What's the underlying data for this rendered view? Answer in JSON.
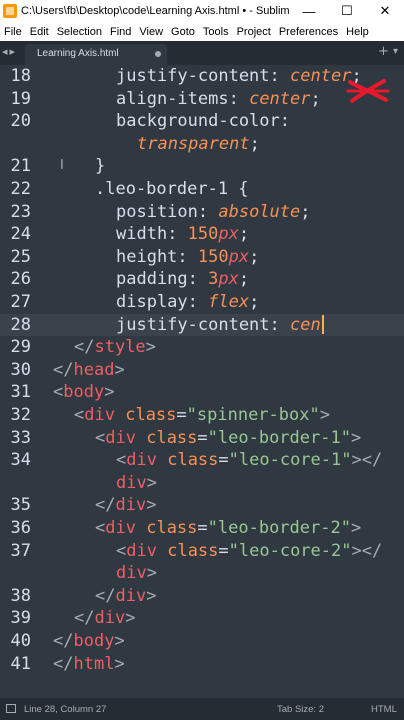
{
  "window": {
    "title": "C:\\Users\\fb\\Desktop\\code\\Learning Axis.html • - Sublime Te...",
    "minimize": "—",
    "maximize": "☐",
    "close": "✕"
  },
  "menu": [
    "File",
    "Edit",
    "Selection",
    "Find",
    "View",
    "Goto",
    "Tools",
    "Project",
    "Preferences",
    "Help"
  ],
  "tabbar": {
    "nav": "◂▸",
    "tab_label": "Learning Axis.html",
    "new_tab": "+",
    "dropdown": "▾"
  },
  "editor": {
    "cursor_line": 28,
    "lines": [
      {
        "n": "18",
        "indent": 3,
        "tokens": [
          {
            "t": "justify-content",
            "c": "k"
          },
          {
            "t": ": ",
            "c": "pun"
          },
          {
            "t": "center",
            "c": "v"
          },
          {
            "t": ";",
            "c": "pun"
          }
        ]
      },
      {
        "n": "19",
        "indent": 3,
        "tokens": [
          {
            "t": "align-items",
            "c": "k"
          },
          {
            "t": ": ",
            "c": "pun"
          },
          {
            "t": "center",
            "c": "v"
          },
          {
            "t": ";",
            "c": "pun"
          }
        ]
      },
      {
        "n": "20",
        "indent": 3,
        "tokens": [
          {
            "t": "background-color",
            "c": "k"
          },
          {
            "t": ":",
            "c": "pun"
          }
        ]
      },
      {
        "n": "",
        "indent": 4,
        "tokens": [
          {
            "t": "transparent",
            "c": "v"
          },
          {
            "t": ";",
            "c": "pun"
          }
        ]
      },
      {
        "n": "21",
        "indent": 2,
        "tokens": [
          {
            "t": "}",
            "c": "pun"
          }
        ]
      },
      {
        "n": "22",
        "indent": 2,
        "tokens": [
          {
            "t": ".leo-border-1",
            "c": "k"
          },
          {
            "t": " {",
            "c": "pun"
          }
        ]
      },
      {
        "n": "23",
        "indent": 3,
        "tokens": [
          {
            "t": "position",
            "c": "k"
          },
          {
            "t": ": ",
            "c": "pun"
          },
          {
            "t": "absolute",
            "c": "v"
          },
          {
            "t": ";",
            "c": "pun"
          }
        ]
      },
      {
        "n": "24",
        "indent": 3,
        "tokens": [
          {
            "t": "width",
            "c": "k"
          },
          {
            "t": ": ",
            "c": "pun"
          },
          {
            "t": "150",
            "c": "n"
          },
          {
            "t": "px",
            "c": "u"
          },
          {
            "t": ";",
            "c": "pun"
          }
        ]
      },
      {
        "n": "25",
        "indent": 3,
        "tokens": [
          {
            "t": "height",
            "c": "k"
          },
          {
            "t": ": ",
            "c": "pun"
          },
          {
            "t": "150",
            "c": "n"
          },
          {
            "t": "px",
            "c": "u"
          },
          {
            "t": ";",
            "c": "pun"
          }
        ]
      },
      {
        "n": "26",
        "indent": 3,
        "tokens": [
          {
            "t": "padding",
            "c": "k"
          },
          {
            "t": ": ",
            "c": "pun"
          },
          {
            "t": "3",
            "c": "n"
          },
          {
            "t": "px",
            "c": "u"
          },
          {
            "t": ";",
            "c": "pun"
          }
        ]
      },
      {
        "n": "27",
        "indent": 3,
        "tokens": [
          {
            "t": "display",
            "c": "k"
          },
          {
            "t": ": ",
            "c": "pun"
          },
          {
            "t": "flex",
            "c": "v"
          },
          {
            "t": ";",
            "c": "pun"
          }
        ]
      },
      {
        "n": "28",
        "indent": 3,
        "tokens": [
          {
            "t": "justify-content",
            "c": "k"
          },
          {
            "t": ": ",
            "c": "pun"
          },
          {
            "t": "cen",
            "c": "v"
          }
        ],
        "caret": true
      },
      {
        "n": "29",
        "indent": 1,
        "tokens": [
          {
            "t": "</",
            "c": "br"
          },
          {
            "t": "style",
            "c": "tag"
          },
          {
            "t": ">",
            "c": "br"
          }
        ]
      },
      {
        "n": "30",
        "indent": 0,
        "tokens": [
          {
            "t": "</",
            "c": "br"
          },
          {
            "t": "head",
            "c": "tag"
          },
          {
            "t": ">",
            "c": "br"
          }
        ]
      },
      {
        "n": "31",
        "indent": 0,
        "tokens": [
          {
            "t": "<",
            "c": "br"
          },
          {
            "t": "body",
            "c": "tag"
          },
          {
            "t": ">",
            "c": "br"
          }
        ]
      },
      {
        "n": "32",
        "indent": 1,
        "tokens": [
          {
            "t": "<",
            "c": "br"
          },
          {
            "t": "div",
            "c": "tag"
          },
          {
            "t": " ",
            "c": "pun"
          },
          {
            "t": "class",
            "c": "attr"
          },
          {
            "t": "=",
            "c": "pun"
          },
          {
            "t": "\"spinner-box\"",
            "c": "str"
          },
          {
            "t": ">",
            "c": "br"
          }
        ]
      },
      {
        "n": "33",
        "indent": 2,
        "tokens": [
          {
            "t": "<",
            "c": "br"
          },
          {
            "t": "div",
            "c": "tag"
          },
          {
            "t": " ",
            "c": "pun"
          },
          {
            "t": "class",
            "c": "attr"
          },
          {
            "t": "=",
            "c": "pun"
          },
          {
            "t": "\"leo-border-1\"",
            "c": "str"
          },
          {
            "t": ">",
            "c": "br"
          }
        ]
      },
      {
        "n": "34",
        "indent": 3,
        "tokens": [
          {
            "t": "<",
            "c": "br"
          },
          {
            "t": "div",
            "c": "tag"
          },
          {
            "t": " ",
            "c": "pun"
          },
          {
            "t": "class",
            "c": "attr"
          },
          {
            "t": "=",
            "c": "pun"
          },
          {
            "t": "\"leo-core-1\"",
            "c": "str"
          },
          {
            "t": "></",
            "c": "br"
          }
        ]
      },
      {
        "n": "",
        "indent": 3,
        "tokens": [
          {
            "t": "div",
            "c": "tag"
          },
          {
            "t": ">",
            "c": "br"
          }
        ]
      },
      {
        "n": "35",
        "indent": 2,
        "tokens": [
          {
            "t": "</",
            "c": "br"
          },
          {
            "t": "div",
            "c": "tag"
          },
          {
            "t": ">",
            "c": "br"
          }
        ]
      },
      {
        "n": "36",
        "indent": 2,
        "tokens": [
          {
            "t": "<",
            "c": "br"
          },
          {
            "t": "div",
            "c": "tag"
          },
          {
            "t": " ",
            "c": "pun"
          },
          {
            "t": "class",
            "c": "attr"
          },
          {
            "t": "=",
            "c": "pun"
          },
          {
            "t": "\"leo-border-2\"",
            "c": "str"
          },
          {
            "t": ">",
            "c": "br"
          }
        ]
      },
      {
        "n": "37",
        "indent": 3,
        "tokens": [
          {
            "t": "<",
            "c": "br"
          },
          {
            "t": "div",
            "c": "tag"
          },
          {
            "t": " ",
            "c": "pun"
          },
          {
            "t": "class",
            "c": "attr"
          },
          {
            "t": "=",
            "c": "pun"
          },
          {
            "t": "\"leo-core-2\"",
            "c": "str"
          },
          {
            "t": "></",
            "c": "br"
          }
        ]
      },
      {
        "n": "",
        "indent": 3,
        "tokens": [
          {
            "t": "div",
            "c": "tag"
          },
          {
            "t": ">",
            "c": "br"
          }
        ]
      },
      {
        "n": "38",
        "indent": 2,
        "tokens": [
          {
            "t": "</",
            "c": "br"
          },
          {
            "t": "div",
            "c": "tag"
          },
          {
            "t": ">",
            "c": "br"
          }
        ]
      },
      {
        "n": "39",
        "indent": 1,
        "tokens": [
          {
            "t": "</",
            "c": "br"
          },
          {
            "t": "div",
            "c": "tag"
          },
          {
            "t": ">",
            "c": "br"
          }
        ]
      },
      {
        "n": "40",
        "indent": 0,
        "tokens": [
          {
            "t": "</",
            "c": "br"
          },
          {
            "t": "body",
            "c": "tag"
          },
          {
            "t": ">",
            "c": "br"
          }
        ]
      },
      {
        "n": "41",
        "indent": 0,
        "tokens": [
          {
            "t": "</",
            "c": "br"
          },
          {
            "t": "html",
            "c": "tag"
          },
          {
            "t": ">",
            "c": "br"
          }
        ]
      }
    ]
  },
  "status": {
    "position": "Line 28, Column 27",
    "tab_size": "Tab Size: 2",
    "syntax": "HTML"
  },
  "colors": {
    "background": "#303841",
    "caret": "#f9ae58",
    "tag": "#ec5f66",
    "string": "#99c794",
    "value": "#f99157"
  }
}
